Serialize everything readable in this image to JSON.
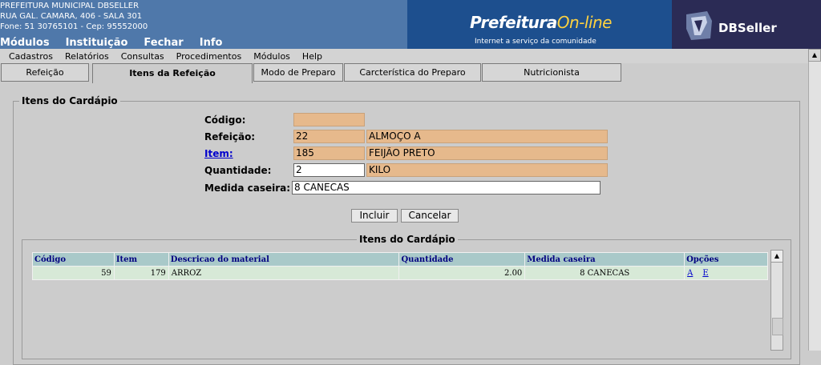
{
  "header": {
    "org_name": "PREFEITURA MUNICIPAL DBSELLER",
    "address": "RUA GAL. CAMARA, 406 - SALA 301",
    "phone": "Fone: 51 30765101  -  Cep: 95552000",
    "logo_main": "Prefeitura",
    "logo_accent": "On-line",
    "logo_tagline": "Internet a serviço da comunidade",
    "brand": "DBSeller"
  },
  "top_menu": [
    "Módulos",
    "Instituição",
    "Fechar",
    "Info"
  ],
  "menubar": [
    "Cadastros",
    "Relatórios",
    "Consultas",
    "Procedimentos",
    "Módulos",
    "Help"
  ],
  "tabs": [
    "Refeição",
    "Itens da Refeição",
    "Modo de Preparo",
    "Carcterística do Preparo",
    "Nutricionista"
  ],
  "form": {
    "legend": "Itens do Cardápio",
    "codigo_label": "Código:",
    "codigo_value": "",
    "refeicao_label": "Refeição:",
    "refeicao_code": "22",
    "refeicao_desc": "ALMOÇO A",
    "item_label": "Item:",
    "item_code": "185",
    "item_desc": "FEIJÃO PRETO",
    "quantidade_label": "Quantidade:",
    "quantidade_value": "2",
    "quantidade_unit": "KILO",
    "medida_label": "Medida caseira:",
    "medida_value": "8 CANECAS",
    "btn_incluir": "Incluir",
    "btn_cancelar": "Cancelar"
  },
  "grid": {
    "legend": "Itens do Cardápio",
    "headers": [
      "Código",
      "Item",
      "Descricao do material",
      "Quantidade",
      "Medida caseira",
      "Opções"
    ],
    "rows": [
      {
        "codigo": "59",
        "item": "179",
        "descricao": "ARROZ",
        "quantidade": "2.00",
        "medida": "8 CANECAS",
        "opt_a": "A",
        "opt_e": "E"
      }
    ]
  },
  "colors": {
    "header_bg": "#4f78aa",
    "readonly_field": "#e6b98c",
    "grid_header": "#a9c9c9",
    "grid_row": "#d7e9d7",
    "link": "#0000cc"
  }
}
